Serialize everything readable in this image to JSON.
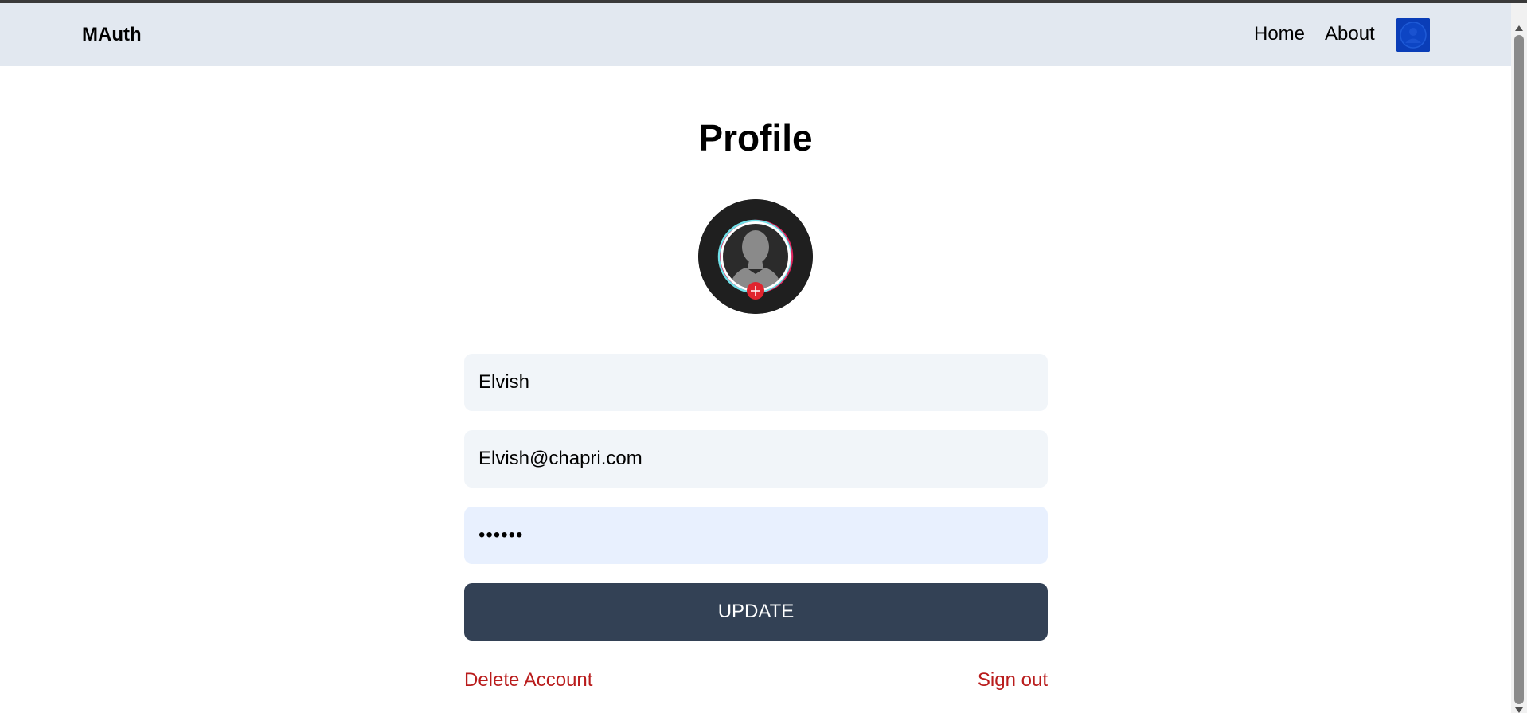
{
  "navbar": {
    "brand": "MAuth",
    "links": [
      {
        "label": "Home"
      },
      {
        "label": "About"
      }
    ],
    "avatar_icon": "user-avatar-icon"
  },
  "profile": {
    "title": "Profile",
    "avatar_icon": "default-user-silhouette-icon",
    "add_photo_icon": "plus-icon",
    "username_value": "Elvish",
    "email_value": "Elvish@chapri.com",
    "password_value": "••••••",
    "update_label": "UPDATE",
    "delete_label": "Delete Account",
    "signout_label": "Sign out"
  },
  "colors": {
    "navbar_bg": "#e2e8f0",
    "input_bg": "#f1f5f9",
    "password_bg": "#e8f0fe",
    "button_bg": "#334155",
    "danger_text": "#b91c1c",
    "avatar_bg": "#0a3db7"
  }
}
